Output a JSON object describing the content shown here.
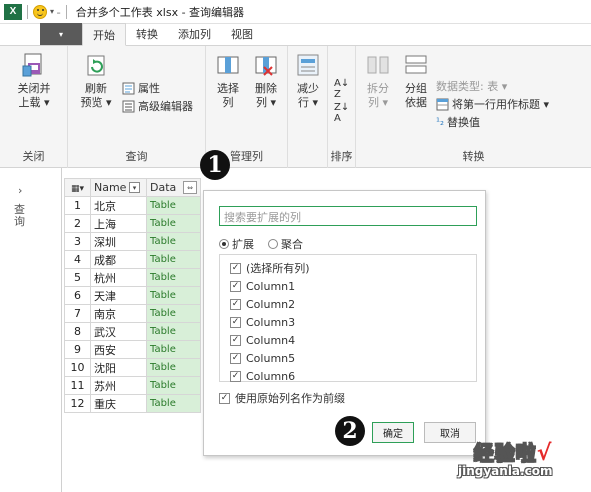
{
  "title_bar": {
    "app_logo": "X",
    "title": "合并多个工作表 xlsx - 查询编辑器"
  },
  "tabs": [
    {
      "label": "开始",
      "active": true
    },
    {
      "label": "转换",
      "active": false
    },
    {
      "label": "添加列",
      "active": false
    },
    {
      "label": "视图",
      "active": false
    }
  ],
  "ribbon": {
    "close_group": {
      "label": "关闭",
      "close_load": [
        "关闭并",
        "上载 ▾"
      ]
    },
    "query_group": {
      "label": "查询",
      "refresh": [
        "刷新",
        "预览 ▾"
      ],
      "properties": "属性",
      "advanced_editor": "高级编辑器"
    },
    "manage_cols_group": {
      "label": "管理列",
      "choose": [
        "选择",
        "列"
      ],
      "remove": [
        "删除",
        "列 ▾"
      ]
    },
    "reduce_rows": [
      "减少",
      "行 ▾"
    ],
    "sort_group": {
      "label": "排序"
    },
    "transform_group": {
      "label": "转换",
      "split": [
        "拆分",
        "列 ▾"
      ],
      "group_by": [
        "分组",
        "依据"
      ],
      "data_type": "数据类型: 表 ▾",
      "first_row_header": "将第一行用作标题 ▾",
      "replace_values": "替换值"
    }
  },
  "nav_pane": {
    "label": "查询"
  },
  "grid": {
    "headers": [
      "Name",
      "Data"
    ],
    "rows": [
      {
        "n": "1",
        "name": "北京",
        "data": "Table"
      },
      {
        "n": "2",
        "name": "上海",
        "data": "Table"
      },
      {
        "n": "3",
        "name": "深圳",
        "data": "Table"
      },
      {
        "n": "4",
        "name": "成都",
        "data": "Table"
      },
      {
        "n": "5",
        "name": "杭州",
        "data": "Table"
      },
      {
        "n": "6",
        "name": "天津",
        "data": "Table"
      },
      {
        "n": "7",
        "name": "南京",
        "data": "Table"
      },
      {
        "n": "8",
        "name": "武汉",
        "data": "Table"
      },
      {
        "n": "9",
        "name": "西安",
        "data": "Table"
      },
      {
        "n": "10",
        "name": "沈阳",
        "data": "Table"
      },
      {
        "n": "11",
        "name": "苏州",
        "data": "Table"
      },
      {
        "n": "12",
        "name": "重庆",
        "data": "Table"
      }
    ]
  },
  "expand_dialog": {
    "search_placeholder": "搜索要扩展的列",
    "radio_expand": "扩展",
    "radio_aggregate": "聚合",
    "columns": [
      "(选择所有列)",
      "Column1",
      "Column2",
      "Column3",
      "Column4",
      "Column5",
      "Column6"
    ],
    "prefix_label": "使用原始列名作为前缀",
    "ok_label": "确定",
    "cancel_label": "取消"
  },
  "markers": {
    "step1": "1",
    "step2": "2"
  },
  "watermark": {
    "text": "经验啦",
    "check": "√",
    "url": "jingyanla.com"
  }
}
